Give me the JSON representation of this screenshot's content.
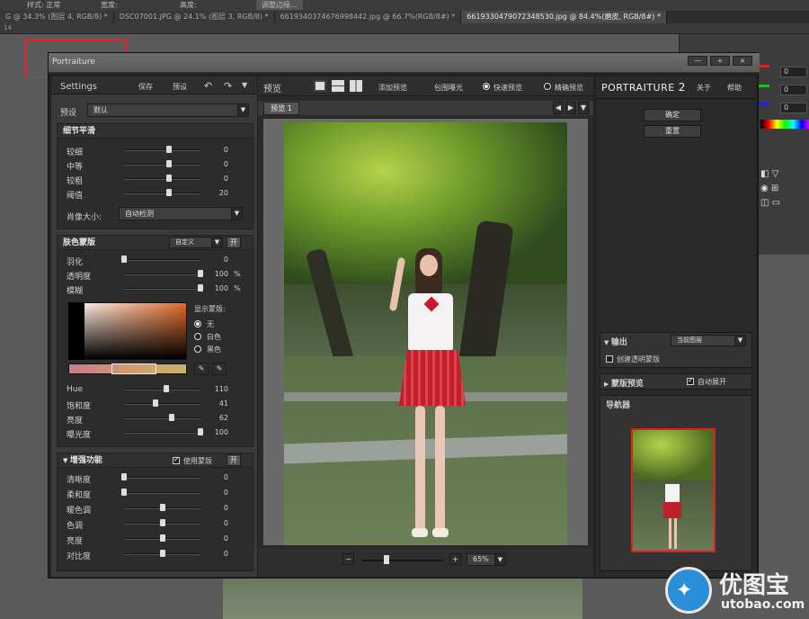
{
  "ps": {
    "top_left_text": "样式: 正常",
    "top_extra": "宽度:",
    "top_extra2": "高度:",
    "top_btn": "调整边缘...",
    "tabs": [
      {
        "label": "G @ 34.3% (图层 4, RGB/8) *"
      },
      {
        "label": "DSC07001.JPG @ 24.1% (图层 3, RGB/8) *"
      },
      {
        "label": "6619340374676998442.jpg @ 66.7%(RGB/8#) *"
      },
      {
        "label": "6619330479072348530.jpg @ 84.4%(磨皮, RGB/8#) *"
      }
    ],
    "ruler_start": "14",
    "right_values": [
      "0",
      "0",
      "0"
    ]
  },
  "dialog": {
    "title": "Portraiture",
    "min_label": "—",
    "max_label": "+",
    "close_label": "×"
  },
  "left": {
    "settings_label": "Settings",
    "save_label": "保存",
    "preset_label": "预设",
    "undo_icon": "undo-icon",
    "redo_icon": "redo-icon",
    "preset_row_label": "预设",
    "preset_value": "默认",
    "detail": {
      "title": "细节平滑",
      "rows": [
        {
          "label": "较细",
          "value": "0",
          "pos": 0.5
        },
        {
          "label": "中等",
          "value": "0",
          "pos": 0.5
        },
        {
          "label": "较粗",
          "value": "0",
          "pos": 0.5
        },
        {
          "label": "阈值",
          "value": "20",
          "pos": 0.5
        }
      ],
      "portrait_size_label": "肖像大小:",
      "portrait_size_value": "自动检测"
    },
    "skin": {
      "title": "肤色蒙版",
      "mode_value": "自定义",
      "toggle_label": "开",
      "rows": [
        {
          "label": "羽化",
          "value": "0",
          "unit": "",
          "pos": 0.0
        },
        {
          "label": "透明度",
          "value": "100",
          "unit": "%",
          "pos": 1.0
        },
        {
          "label": "模糊",
          "value": "100",
          "unit": "%",
          "pos": 1.0
        }
      ],
      "show_mask_label": "显示蒙版:",
      "radio_none": "无",
      "radio_white": "白色",
      "radio_black": "黑色",
      "hsv": [
        {
          "label": "Hue",
          "value": "110",
          "pos": 0.55
        },
        {
          "label": "饱和度",
          "value": "41",
          "pos": 0.41
        },
        {
          "label": "亮度",
          "value": "62",
          "pos": 0.62
        },
        {
          "label": "曝光度",
          "value": "100",
          "pos": 1.0
        }
      ]
    },
    "enhance": {
      "title": "增强功能",
      "use_mask_label": "使用蒙版",
      "toggle_label": "开",
      "rows": [
        {
          "label": "清晰度",
          "value": "0",
          "pos": 0.0
        },
        {
          "label": "柔和度",
          "value": "0",
          "pos": 0.0
        },
        {
          "label": "暖色调",
          "value": "0",
          "pos": 0.5
        },
        {
          "label": "色调",
          "value": "0",
          "pos": 0.5
        },
        {
          "label": "亮度",
          "value": "0",
          "pos": 0.5
        },
        {
          "label": "对比度",
          "value": "0",
          "pos": 0.5
        }
      ]
    }
  },
  "center": {
    "preview_label": "预览",
    "add_preview_label": "添加预览",
    "fit_exposure_label": "包围曝光",
    "fast_preview_label": "快速预览",
    "accurate_preview_label": "精确预览",
    "preview_tab": "预览 1",
    "zoom_minus": "−",
    "zoom_plus": "+",
    "zoom_value": "65%",
    "zoom_level": 0.3
  },
  "right": {
    "brand": "PORTRAITURE",
    "brand_num": "2",
    "about_label": "关于",
    "help_label": "帮助",
    "ok_label": "确定",
    "reset_label": "重置",
    "output_label": "输出",
    "output_value": "当前图层",
    "create_mask_label": "创建透明蒙版",
    "mask_preview_label": "蒙版预览",
    "auto_expand_label": "自动展开",
    "navigator_label": "导航器"
  },
  "watermark": {
    "text": "优图宝",
    "url": "utobao.com"
  }
}
